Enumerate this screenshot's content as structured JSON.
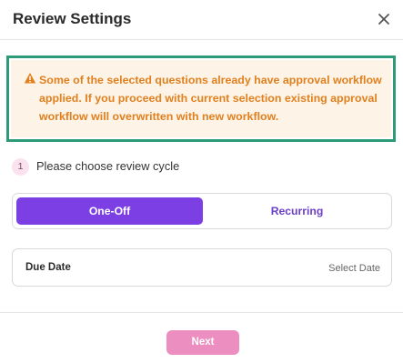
{
  "header": {
    "title": "Review Settings",
    "close_icon": "close-icon"
  },
  "alert": {
    "icon": "warning-triangle-icon",
    "color": "#e0801f",
    "background": "#fdf3e6",
    "outline_color": "#2e9b78",
    "text": "Some of the selected questions already have approval workflow applied. If you proceed with current selection existing approval workflow will overwritten with new workflow."
  },
  "step": {
    "number": "1",
    "label": "Please choose review cycle"
  },
  "cycle_toggle": {
    "options": [
      {
        "label": "One-Off",
        "selected": true
      },
      {
        "label": "Recurring",
        "selected": false
      }
    ],
    "accent": "#7b3fe4"
  },
  "due_date": {
    "label": "Due Date",
    "value": "Select Date"
  },
  "footer": {
    "next_label": "Next",
    "next_color": "#ec8fc0"
  }
}
